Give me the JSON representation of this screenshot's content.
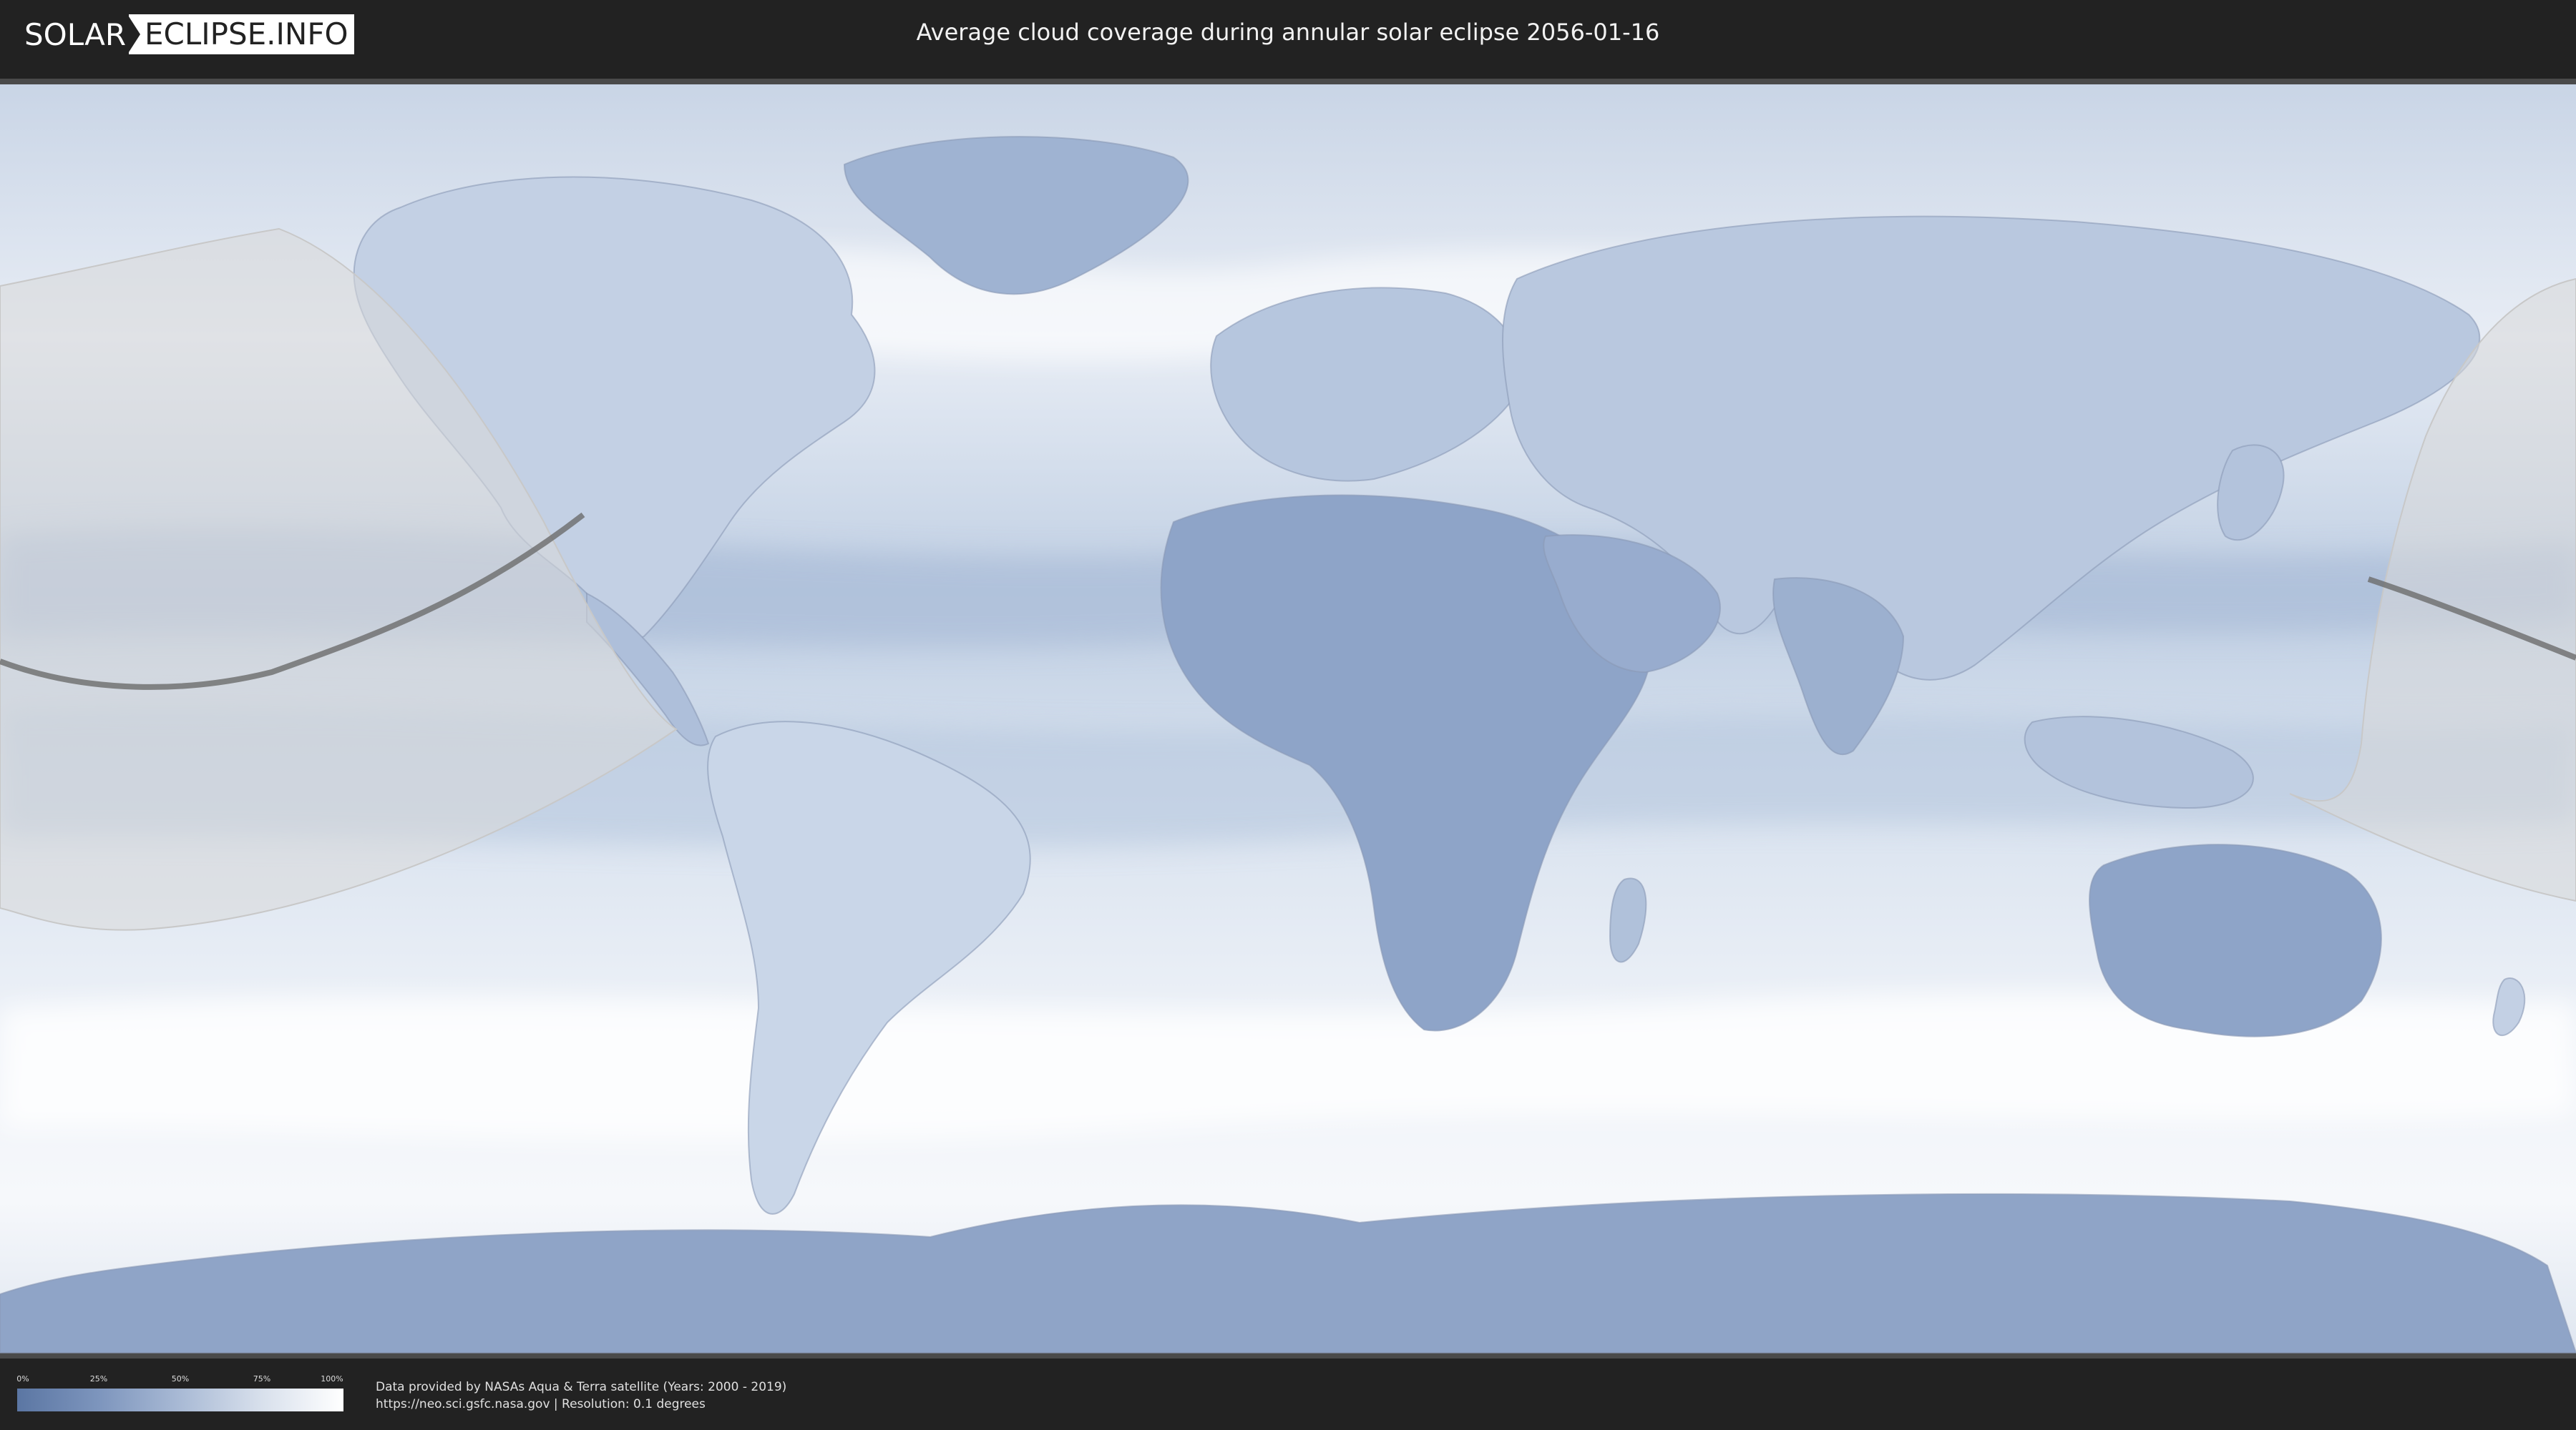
{
  "header": {
    "logo_left": "SOLAR",
    "logo_right": "ECLIPSE.INFO",
    "title": "Average cloud coverage during annular solar eclipse 2056-01-16"
  },
  "map": {
    "colors": {
      "clear": "#5b76a3",
      "cloudy": "#ffffff",
      "eclipse_zone": "#d9d9d9",
      "path": "#666666"
    }
  },
  "legend": {
    "ticks": [
      "0%",
      "25%",
      "50%",
      "75%",
      "100%"
    ]
  },
  "footer": {
    "credit_line1": "Data provided by NASAs Aqua & Terra satellite (Years: 2000 - 2019)",
    "credit_line2": "https://neo.sci.gsfc.nasa.gov | Resolution: 0.1 degrees"
  }
}
